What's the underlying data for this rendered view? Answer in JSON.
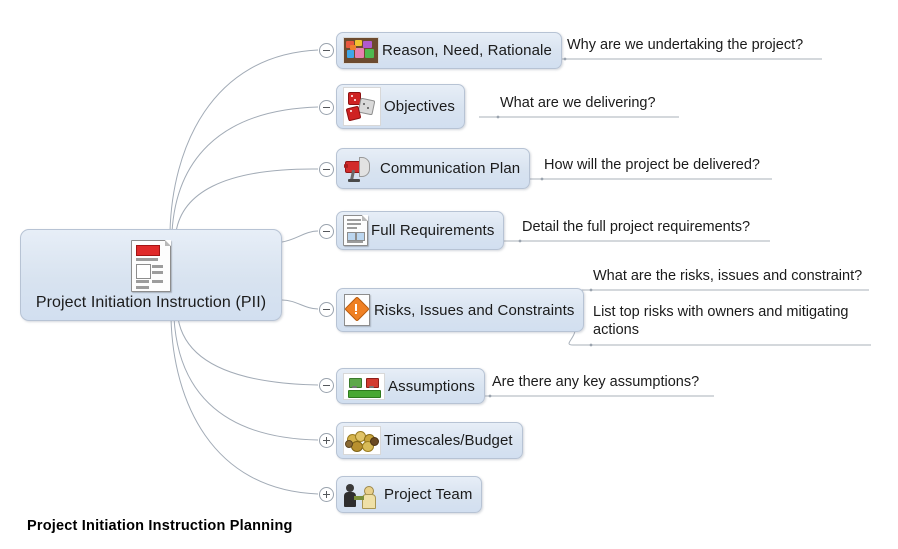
{
  "caption": "Project Initiation Instruction Planning",
  "root": {
    "label": "Project Initiation Instruction (PII)",
    "icon": "document-icon"
  },
  "colors": {
    "node_fill_top": "#e7eef7",
    "node_fill_bottom": "#d2dff0",
    "node_border": "#b7c3d4",
    "connector": "#9aa3ae",
    "text": "#1b1b1b"
  },
  "branches": [
    {
      "label": "Reason, Need, Rationale",
      "icon": "colored-blocks-icon",
      "toggle": "minus",
      "annotations": [
        "Why are we undertaking the project?"
      ]
    },
    {
      "label": "Objectives",
      "icon": "dice-icon",
      "toggle": "minus",
      "annotations": [
        "What are we delivering?"
      ]
    },
    {
      "label": "Communication Plan",
      "icon": "megaphone-icon",
      "toggle": "minus",
      "annotations": [
        "How will the project be delivered?"
      ]
    },
    {
      "label": "Full Requirements",
      "icon": "document-icon",
      "toggle": "minus",
      "annotations": [
        "Detail the full project requirements?"
      ]
    },
    {
      "label": "Risks, Issues and Constraints",
      "icon": "warning-document-icon",
      "toggle": "minus",
      "annotations": [
        "What are the risks, issues and constraint?",
        "List top risks with owners and mitigating actions"
      ]
    },
    {
      "label": "Assumptions",
      "icon": "monitors-icon",
      "toggle": "minus",
      "annotations": [
        "Are there any key assumptions?"
      ]
    },
    {
      "label": "Timescales/Budget",
      "icon": "money-icon",
      "toggle": "plus",
      "annotations": []
    },
    {
      "label": "Project Team",
      "icon": "team-icon",
      "toggle": "plus",
      "annotations": []
    }
  ]
}
